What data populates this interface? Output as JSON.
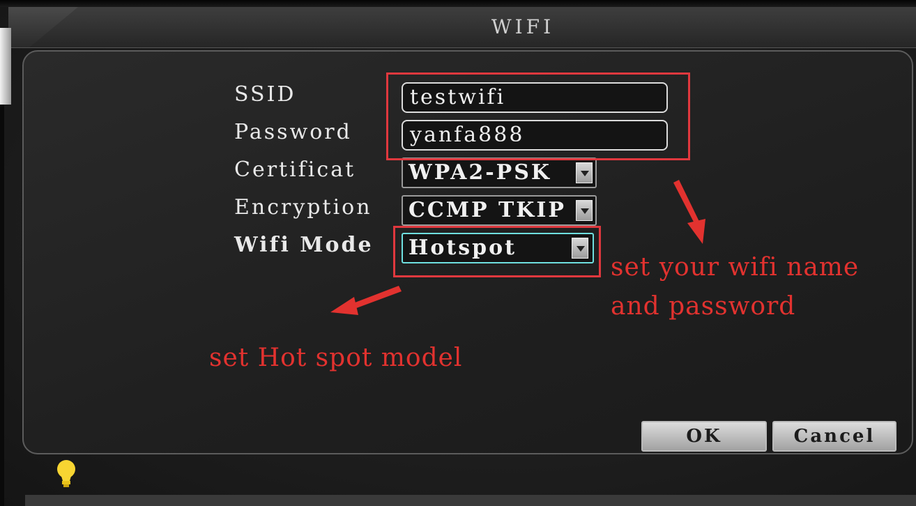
{
  "window": {
    "title": "WIFI"
  },
  "form": {
    "ssid": {
      "label": "SSID",
      "value": "testwifi"
    },
    "password": {
      "label": "Password",
      "value": "yanfa888"
    },
    "certificate": {
      "label": "Certificat",
      "value": "WPA2-PSK"
    },
    "encryption": {
      "label": "Encryption",
      "value": "CCMP TKIP"
    },
    "wifi_mode": {
      "label": "Wifi Mode",
      "value": "Hotspot"
    }
  },
  "buttons": {
    "ok": "OK",
    "cancel": "Cancel"
  },
  "annotations": {
    "wifi_note_line1": "set your wifi name",
    "wifi_note_line2": "and password",
    "mode_note": "set Hot spot model",
    "color": "#e2322f"
  },
  "icons": {
    "status": "lightbulb-icon"
  }
}
